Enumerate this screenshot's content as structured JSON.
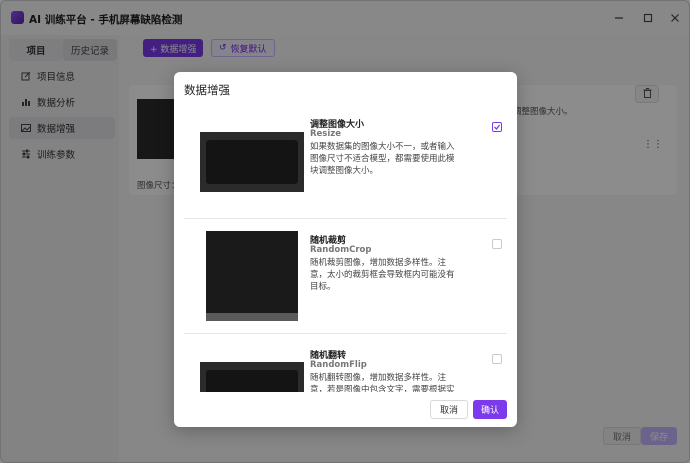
{
  "window": {
    "title": "AI 训练平台 - 手机屏幕缺陷检测",
    "minimize_icon": "minimize-icon",
    "maximize_icon": "maximize-icon",
    "close_icon": "close-icon"
  },
  "sidebar": {
    "tabs": [
      {
        "label": "项目",
        "active": true
      },
      {
        "label": "历史记录",
        "active": false
      }
    ],
    "items": [
      {
        "label": "项目信息",
        "icon": "edit-icon",
        "active": false
      },
      {
        "label": "数据分析",
        "icon": "bar-chart-icon",
        "active": false
      },
      {
        "label": "数据增强",
        "icon": "image-icon",
        "active": true
      },
      {
        "label": "训练参数",
        "icon": "sliders-icon",
        "active": false
      }
    ]
  },
  "toolbar": {
    "add_label": "+ 数据增强",
    "reset_label": "恢复默认"
  },
  "main": {
    "bg_text": "调整图像大小。",
    "size_label": "图像尺寸："
  },
  "footer": {
    "cancel_label": "取消",
    "save_label": "保存"
  },
  "dialog": {
    "title": "数据增强",
    "items": [
      {
        "name": "调整图像大小",
        "sub": "Resize",
        "desc": "如果数据集的图像大小不一，或者输入图像尺寸不适合模型，都需要使用此模块调整图像大小。",
        "checked": true
      },
      {
        "name": "随机裁剪",
        "sub": "RandomCrop",
        "desc": "随机裁剪图像，增加数据多样性。注意，太小的裁剪框会导致框内可能没有目标。",
        "checked": false
      },
      {
        "name": "随机翻转",
        "sub": "RandomFlip",
        "desc": "随机翻转图像，增加数据多样性。注意，若是图像中包含文字，需要根据实",
        "checked": false
      }
    ],
    "cancel_label": "取消",
    "confirm_label": "确认"
  },
  "colors": {
    "accent": "#7c3aed",
    "overlay": "#00000073"
  }
}
